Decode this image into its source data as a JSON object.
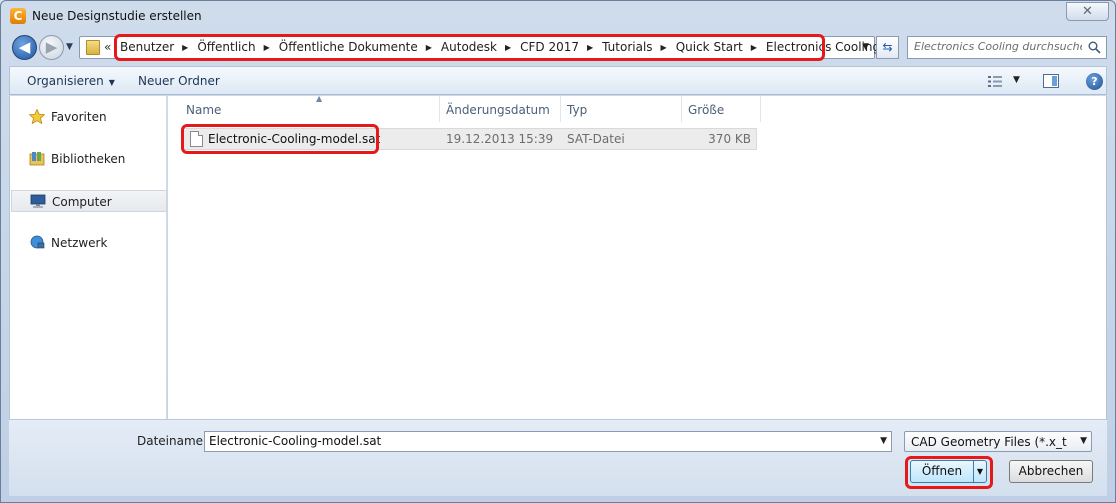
{
  "window": {
    "title": "Neue Designstudie erstellen",
    "app_icon_letter": "C"
  },
  "nav": {
    "back_glyph": "◀",
    "forward_glyph": "▶"
  },
  "address": {
    "overflow": "«",
    "crumbs": [
      "Benutzer",
      "Öffentlich",
      "Öffentliche Dokumente",
      "Autodesk",
      "CFD 2017",
      "Tutorials",
      "Quick Start",
      "Electronics Cooling"
    ]
  },
  "search": {
    "placeholder": "Electronics Cooling durchsuchen"
  },
  "toolbar": {
    "organize_label": "Organisieren",
    "new_folder_label": "Neuer Ordner"
  },
  "sidebar": {
    "items": [
      {
        "label": "Favoriten",
        "icon": "star-icon"
      },
      {
        "label": "Bibliotheken",
        "icon": "library-icon"
      },
      {
        "label": "Computer",
        "icon": "computer-icon",
        "selected": true
      },
      {
        "label": "Netzwerk",
        "icon": "network-icon"
      }
    ]
  },
  "columns": {
    "name": "Name",
    "modified": "Änderungsdatum",
    "type": "Typ",
    "size": "Größe"
  },
  "files": [
    {
      "name": "Electronic-Cooling-model.sat",
      "modified": "19.12.2013 15:39",
      "type": "SAT-Datei",
      "size": "370 KB"
    }
  ],
  "footer": {
    "filename_label": "Dateiname:",
    "filename_value": "Electronic-Cooling-model.sat",
    "filetype_value": "CAD Geometry Files (*.x_t *.sat",
    "open_label": "Öffnen",
    "cancel_label": "Abbrechen"
  },
  "colors": {
    "highlight": "#e41a1a",
    "accent": "#1d56a8"
  }
}
